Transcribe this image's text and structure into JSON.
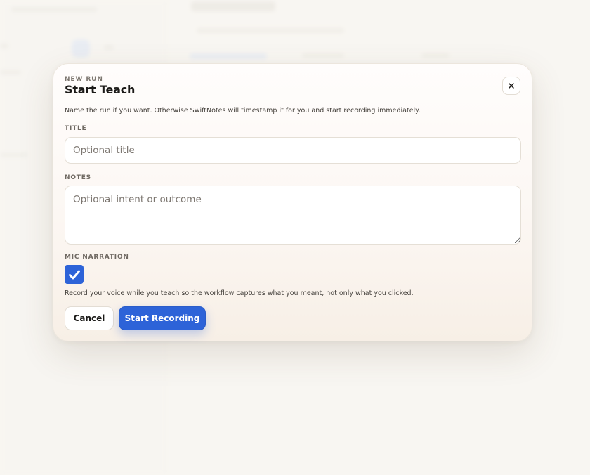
{
  "dialog": {
    "eyebrow": "NEW RUN",
    "title": "Start Teach",
    "close_label": "×",
    "description": "Name the run if you want. Otherwise SwiftNotes will timestamp it for you and start recording immediately."
  },
  "fields": {
    "title_label": "TITLE",
    "title_placeholder": "Optional title",
    "title_value": "",
    "notes_label": "NOTES",
    "notes_placeholder": "Optional intent or outcome",
    "notes_value": "",
    "mic_label": "MIC NARRATION",
    "mic_checked": true,
    "mic_help": "Record your voice while you teach so the workflow captures what you meant, not only what you clicked."
  },
  "actions": {
    "cancel_label": "Cancel",
    "start_label": "Start Recording"
  },
  "icons": {
    "close": "close-icon",
    "check": "checkmark-icon"
  },
  "colors": {
    "accent": "#2d63d8",
    "page_background": "#f6f4ef",
    "text_primary": "#1b1a18",
    "text_muted": "#6f6962"
  }
}
